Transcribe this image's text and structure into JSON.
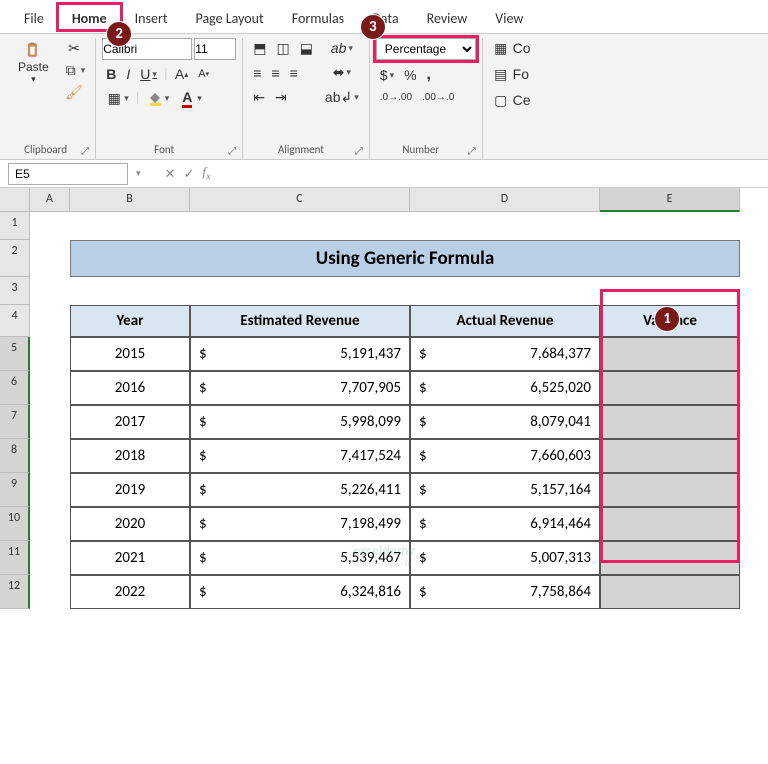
{
  "tabs": [
    "File",
    "Home",
    "Insert",
    "Page Layout",
    "Formulas",
    "Data",
    "Review",
    "View"
  ],
  "active_tab": "Home",
  "clipboard": {
    "label": "Clipboard",
    "paste": "Paste"
  },
  "font": {
    "label": "Font",
    "name": "Calibri",
    "size": "11",
    "bold": "B",
    "italic": "I",
    "underline": "U"
  },
  "alignment": {
    "label": "Alignment"
  },
  "number": {
    "label": "Number",
    "format": "Percentage",
    "currency": "$",
    "percent": "%",
    "comma": ","
  },
  "styles_partial": {
    "cond": "Co",
    "fmt": "Fo",
    "cell": "Ce"
  },
  "namebox": "E5",
  "columns": [
    "A",
    "B",
    "C",
    "D",
    "E"
  ],
  "row_numbers": [
    1,
    2,
    3,
    4,
    5,
    6,
    7,
    8,
    9,
    10,
    11,
    12
  ],
  "title": "Using Generic Formula",
  "headers": [
    "Year",
    "Estimated Revenue",
    "Actual Revenue",
    "Variance"
  ],
  "rows": [
    {
      "year": "2015",
      "est": "5,191,437",
      "act": "7,684,377"
    },
    {
      "year": "2016",
      "est": "7,707,905",
      "act": "6,525,020"
    },
    {
      "year": "2017",
      "est": "5,998,099",
      "act": "8,079,041"
    },
    {
      "year": "2018",
      "est": "7,417,524",
      "act": "7,660,603"
    },
    {
      "year": "2019",
      "est": "5,226,411",
      "act": "5,157,164"
    },
    {
      "year": "2020",
      "est": "7,198,499",
      "act": "6,914,464"
    },
    {
      "year": "2021",
      "est": "5,539,467",
      "act": "5,007,313"
    },
    {
      "year": "2022",
      "est": "6,324,816",
      "act": "7,758,864"
    }
  ],
  "currency_sym": "$",
  "badges": {
    "b1": "1",
    "b2": "2",
    "b3": "3"
  },
  "watermark": {
    "main": "exceldemy",
    "sub": "EXCEL · DATA · BI"
  },
  "chart_data": {
    "type": "table",
    "title": "Using Generic Formula",
    "columns": [
      "Year",
      "Estimated Revenue",
      "Actual Revenue",
      "Variance"
    ],
    "data": [
      [
        "2015",
        5191437,
        7684377,
        null
      ],
      [
        "2016",
        7707905,
        6525020,
        null
      ],
      [
        "2017",
        5998099,
        8079041,
        null
      ],
      [
        "2018",
        7417524,
        7660603,
        null
      ],
      [
        "2019",
        5226411,
        5157164,
        null
      ],
      [
        "2020",
        7198499,
        6914464,
        null
      ],
      [
        "2021",
        5539467,
        5007313,
        null
      ],
      [
        "2022",
        6324816,
        7758864,
        null
      ]
    ]
  }
}
